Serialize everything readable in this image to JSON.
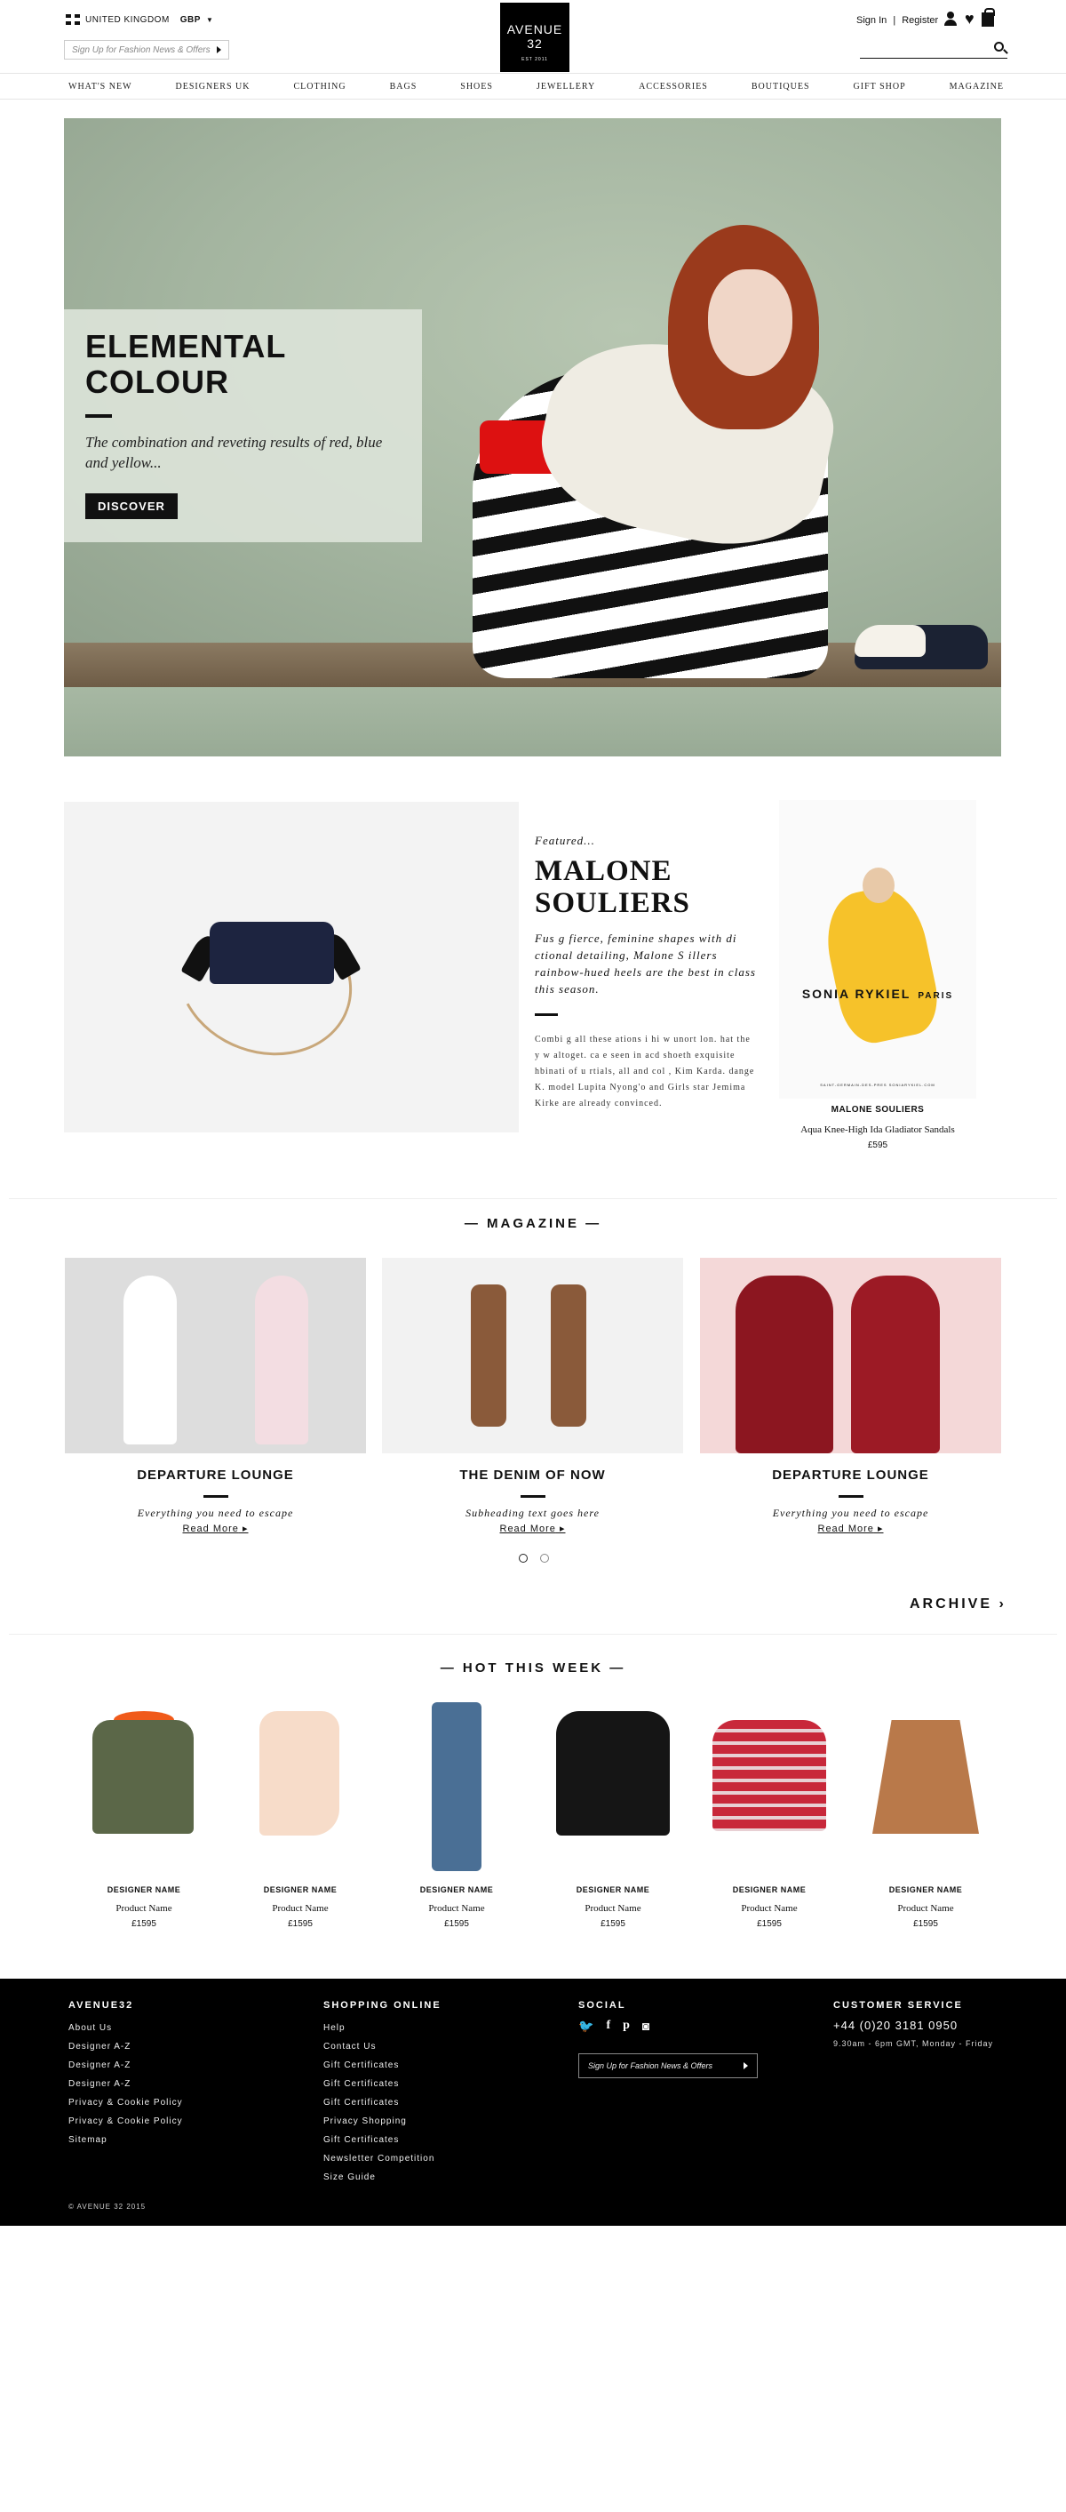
{
  "header": {
    "country": "UNITED KINGDOM",
    "currency": "GBP",
    "signup_placeholder": "Sign Up for Fashion News & Offers",
    "logo": {
      "line1": "AVENUE",
      "line2": "32",
      "line3": "EST 2011"
    },
    "sign_in": "Sign In",
    "divider": "|",
    "register": "Register",
    "icons": [
      "user-icon",
      "heart-icon",
      "bag-icon",
      "search-icon"
    ]
  },
  "nav": [
    "WHAT'S NEW",
    "DESIGNERS UK",
    "CLOTHING",
    "BAGS",
    "SHOES",
    "JEWELLERY",
    "ACCESSORIES",
    "BOUTIQUES",
    "GIFT SHOP",
    "MAGAZINE"
  ],
  "hero": {
    "title": "ELEMENTAL\nCOLOUR",
    "subtitle": "The combination and reveting results of red, blue and yellow...",
    "button": "DISCOVER"
  },
  "featured": {
    "pre": "Featured...",
    "title": "MALONE\nSOULIERS",
    "lead": "Fus g fierce, feminine shapes with di ctional detailing, Malone S illers rainbow-hued heels are the best in class this season.",
    "body": "Combi g all these ations i hi w unort lon. hat the y w altoget. ca e seen in acd shoeth exquisite hbinati of u rtials, all and col , Kim Karda. dange K. model Lupita Nyong'o and Girls star Jemima Kirke are already convinced.",
    "ad": {
      "brand": "SONIA RYKIEL",
      "city": "PARIS",
      "foot": "SAINT-GERMAIN-DES-PRES  SONIARYKIEL.COM"
    },
    "product": {
      "designer": "MALONE SOULIERS",
      "name": "Aqua Knee-High Ida Gladiator Sandals",
      "price": "£595"
    }
  },
  "magazine": {
    "title": "MAGAZINE",
    "cards": [
      {
        "title": "DEPARTURE LOUNGE",
        "subtitle": "Everything you need to escape",
        "link": "Read More"
      },
      {
        "title": "THE DENIM OF NOW",
        "subtitle": "Subheading text goes here",
        "link": "Read More"
      },
      {
        "title": "DEPARTURE LOUNGE",
        "subtitle": "Everything you need to escape",
        "link": "Read More"
      }
    ],
    "archive": "ARCHIVE"
  },
  "hot": {
    "title": "HOT THIS WEEK",
    "items": [
      {
        "designer": "DESIGNER NAME",
        "name": "Product Name",
        "price": "£1595"
      },
      {
        "designer": "DESIGNER NAME",
        "name": "Product Name",
        "price": "£1595"
      },
      {
        "designer": "DESIGNER NAME",
        "name": "Product Name",
        "price": "£1595"
      },
      {
        "designer": "DESIGNER NAME",
        "name": "Product Name",
        "price": "£1595"
      },
      {
        "designer": "DESIGNER NAME",
        "name": "Product Name",
        "price": "£1595"
      },
      {
        "designer": "DESIGNER NAME",
        "name": "Product Name",
        "price": "£1595"
      }
    ]
  },
  "footer": {
    "col1": {
      "title": "AVENUE32",
      "links": [
        "About Us",
        "Designer A-Z",
        "Designer A-Z",
        "Designer A-Z",
        "Privacy & Cookie Policy",
        "Privacy & Cookie Policy",
        "Sitemap"
      ]
    },
    "col2": {
      "title": "SHOPPING ONLINE",
      "links": [
        "Help",
        "Contact Us",
        "Gift Certificates",
        "Gift Certificates",
        "Gift Certificates",
        "Privacy Shopping",
        "Gift Certificates",
        "Newsletter Competition",
        "Size Guide"
      ]
    },
    "col3": {
      "title": "SOCIAL",
      "icons": [
        "twitter-icon",
        "facebook-icon",
        "pinterest-icon",
        "instagram-icon"
      ],
      "signup": "Sign Up for Fashion News & Offers"
    },
    "col4": {
      "title": "CUSTOMER SERVICE",
      "phone": "+44 (0)20 3181 0950",
      "hours": "9.30am - 6pm GMT, Monday - Friday"
    },
    "copyright": "© AVENUE 32 2015"
  }
}
